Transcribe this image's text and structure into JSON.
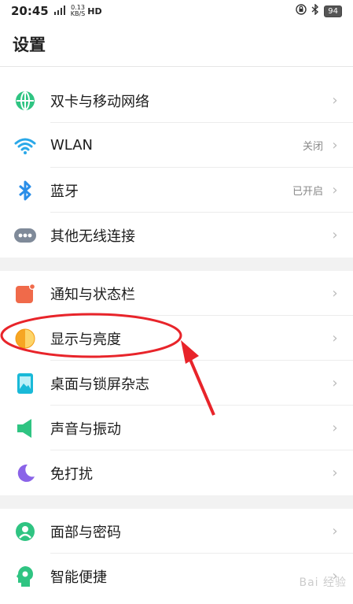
{
  "status_bar": {
    "time": "20:45",
    "signal": "4G",
    "speed": "0.13",
    "speed_unit": "KB/S",
    "hd": "HD",
    "battery": "94"
  },
  "page_title": "设置",
  "groups": [
    {
      "items": [
        {
          "label": "双卡与移动网络",
          "value": "",
          "icon": "globe-icon",
          "color": "#2fc482"
        },
        {
          "label": "WLAN",
          "value": "关闭",
          "icon": "wifi-icon",
          "color": "#2aa8e8"
        },
        {
          "label": "蓝牙",
          "value": "已开启",
          "icon": "bluetooth-icon",
          "color": "#2a8ee8"
        },
        {
          "label": "其他无线连接",
          "value": "",
          "icon": "more-connections-icon",
          "color": "#7f8a99"
        }
      ]
    },
    {
      "items": [
        {
          "label": "通知与状态栏",
          "value": "",
          "icon": "notification-icon",
          "color": "#f06a4a"
        },
        {
          "label": "显示与亮度",
          "value": "",
          "icon": "brightness-icon",
          "color": "#f6a623"
        },
        {
          "label": "桌面与锁屏杂志",
          "value": "",
          "icon": "wallpaper-icon",
          "color": "#19b9d8"
        },
        {
          "label": "声音与振动",
          "value": "",
          "icon": "speaker-icon",
          "color": "#2fc482"
        },
        {
          "label": "免打扰",
          "value": "",
          "icon": "moon-icon",
          "color": "#8a63e8"
        }
      ]
    },
    {
      "items": [
        {
          "label": "面部与密码",
          "value": "",
          "icon": "face-icon",
          "color": "#2fc482"
        },
        {
          "label": "智能便捷",
          "value": "",
          "icon": "smart-icon",
          "color": "#2fc482"
        }
      ]
    }
  ],
  "annotation_color": "#e8242a",
  "watermark": "Bai 经验"
}
